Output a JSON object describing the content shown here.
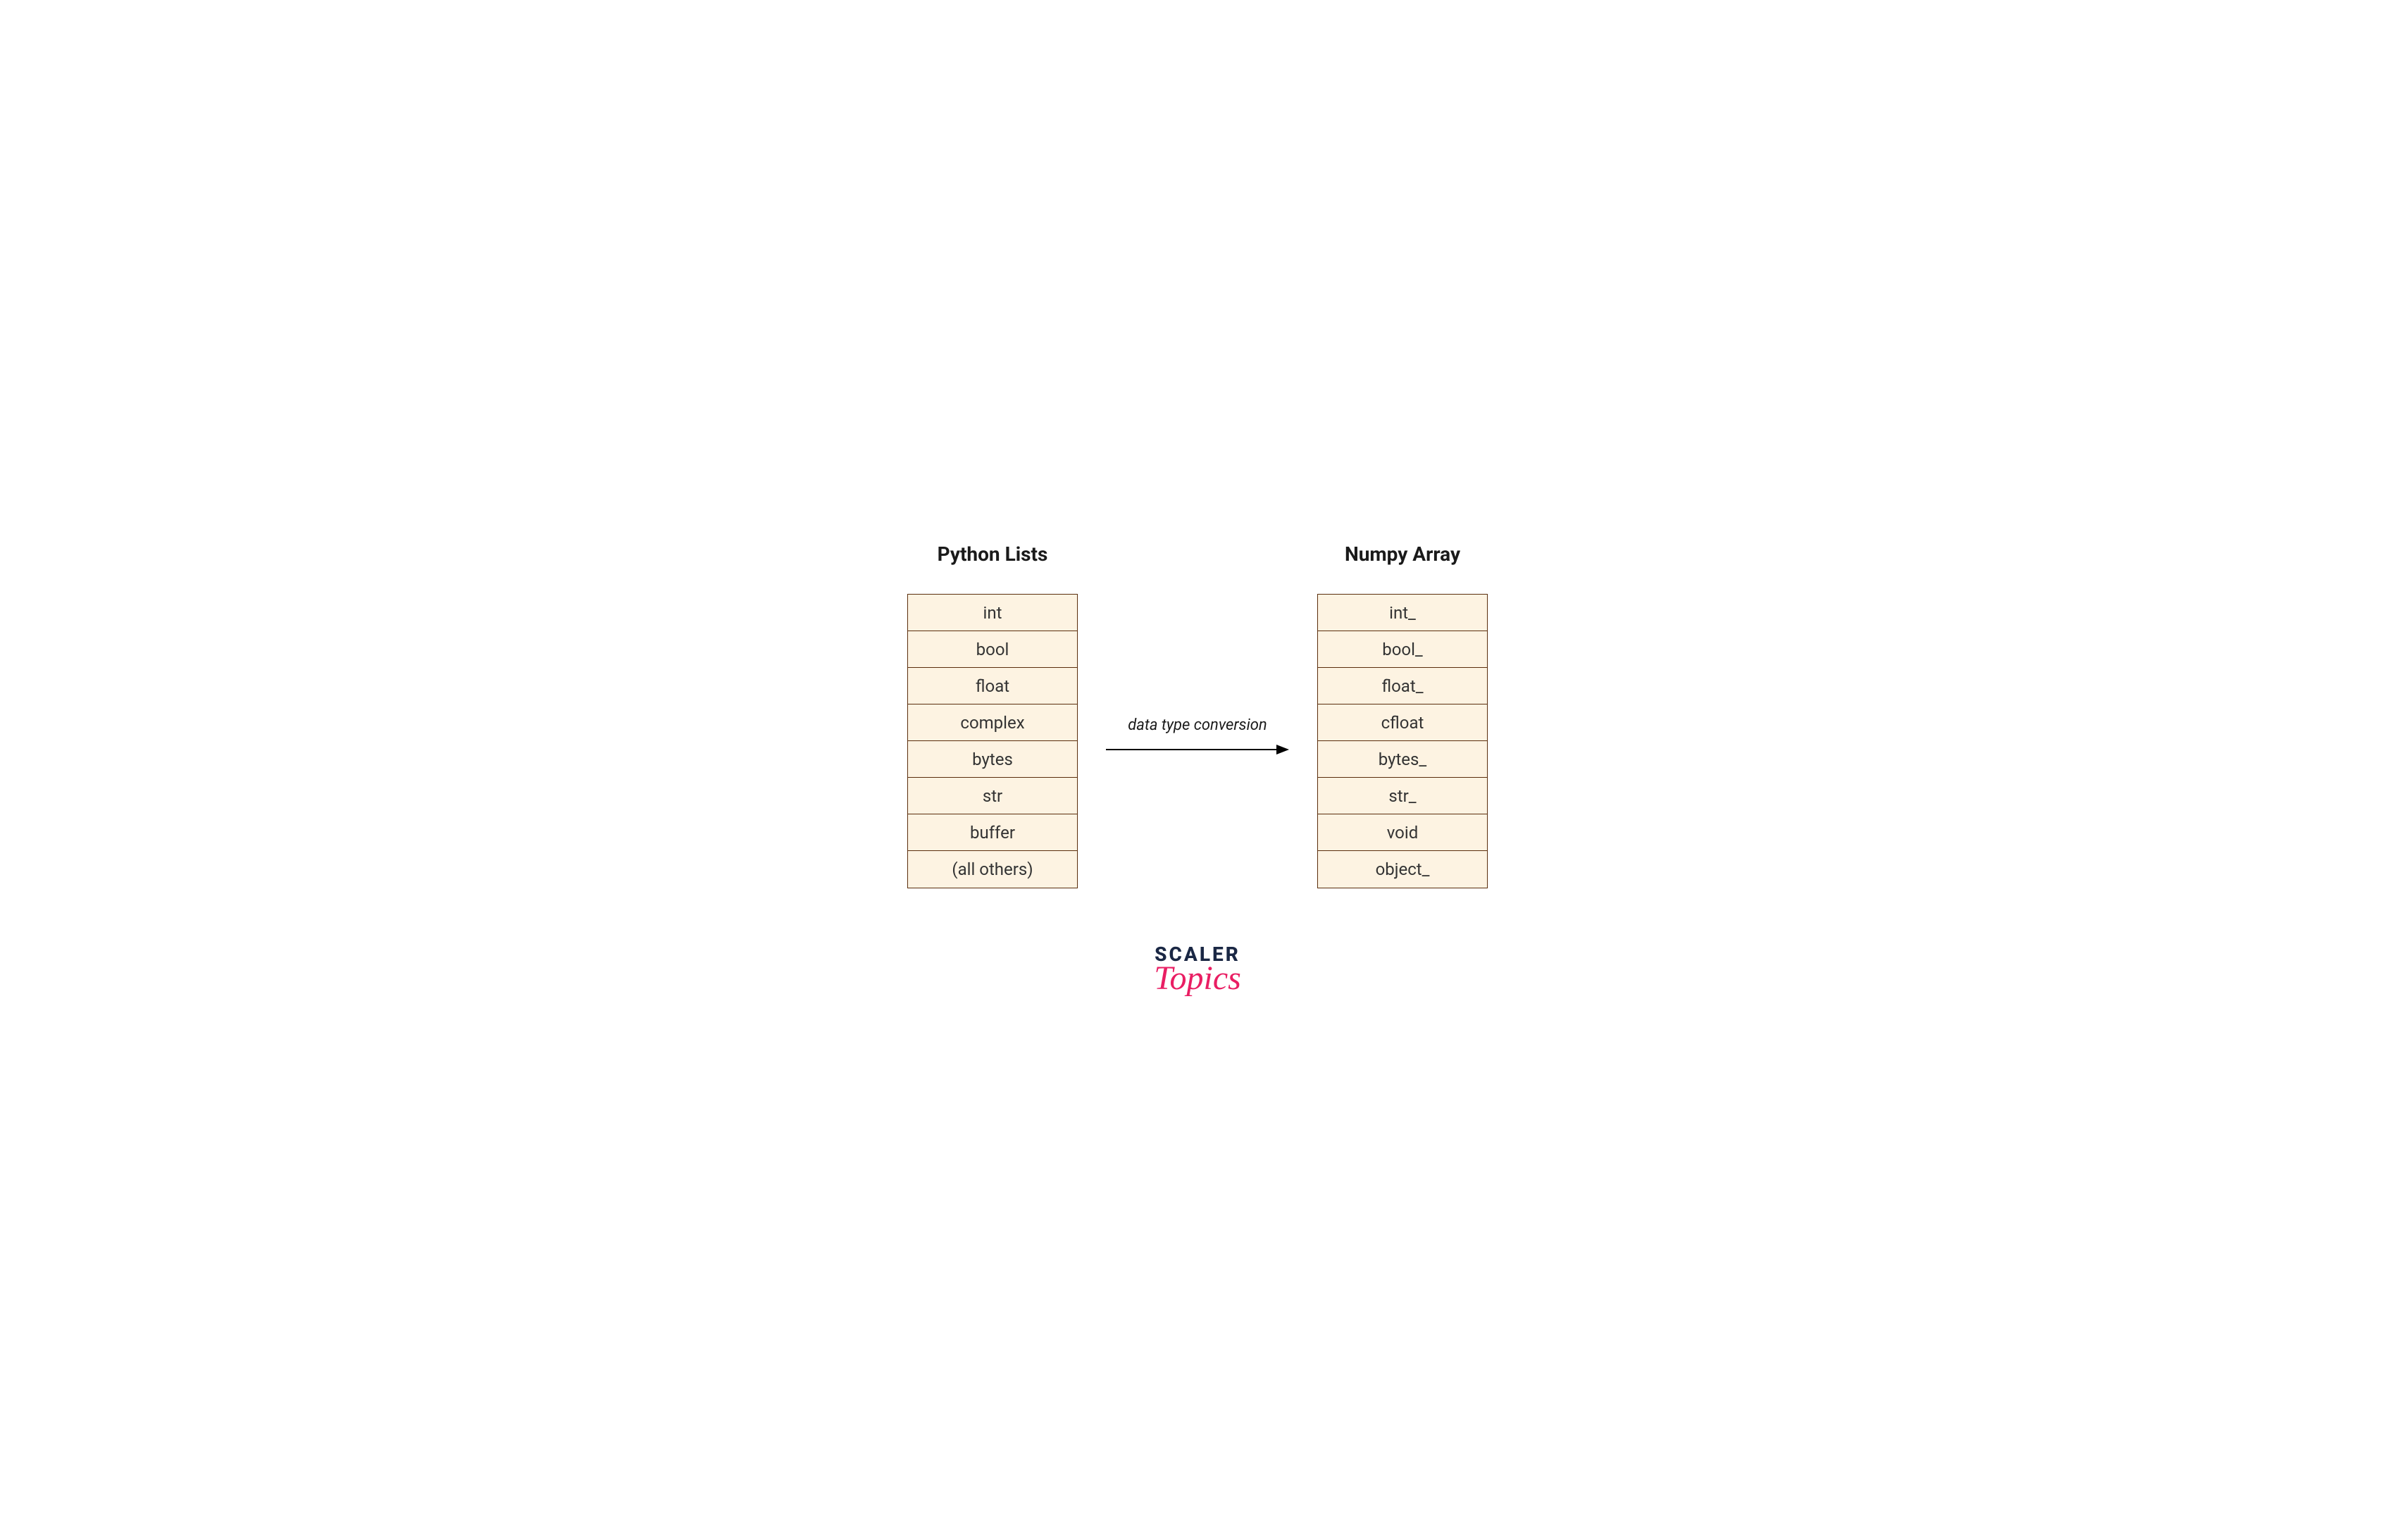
{
  "columns": {
    "left": {
      "title": "Python Lists",
      "items": [
        "int",
        "bool",
        "float",
        "complex",
        "bytes",
        "str",
        "buffer",
        "(all others)"
      ]
    },
    "right": {
      "title": "Numpy Array",
      "items": [
        "int_",
        "bool_",
        "float_",
        "cfloat",
        "bytes_",
        "str_",
        "void",
        "object_"
      ]
    }
  },
  "arrow": {
    "label": "data type conversion"
  },
  "logo": {
    "top": "SCALER",
    "bottom": "Topics"
  }
}
